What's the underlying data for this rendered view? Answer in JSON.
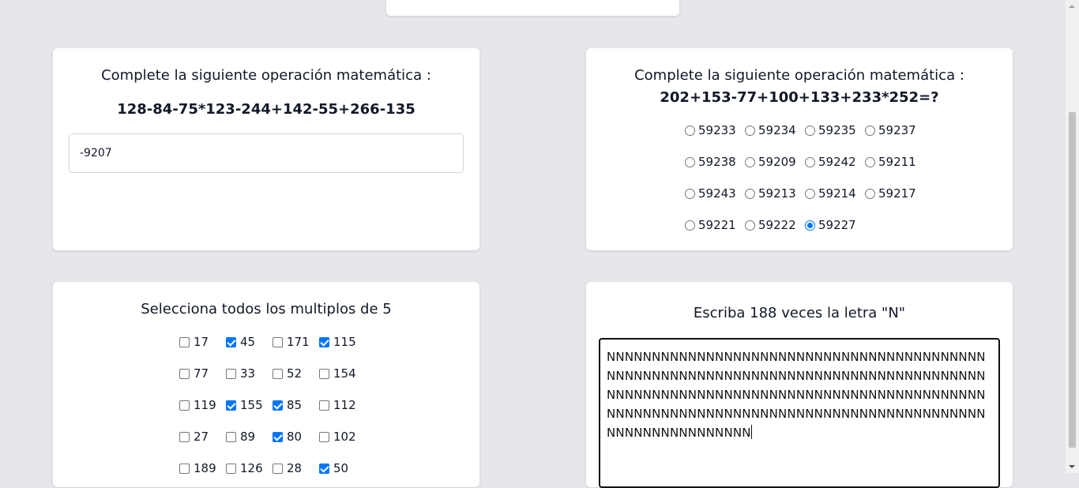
{
  "q1": {
    "title": "Complete la siguiente operación matemática :",
    "expression": "128-84-75*123-244+142-55+266-135",
    "input_value": "-9207"
  },
  "q2": {
    "title": "Complete la siguiente operación matemática :",
    "expression": "202+153-77+100+133+233*252=?",
    "options": [
      {
        "label": "59233",
        "checked": false
      },
      {
        "label": "59234",
        "checked": false
      },
      {
        "label": "59235",
        "checked": false
      },
      {
        "label": "59237",
        "checked": false
      },
      {
        "label": "59238",
        "checked": false
      },
      {
        "label": "59209",
        "checked": false
      },
      {
        "label": "59242",
        "checked": false
      },
      {
        "label": "59211",
        "checked": false
      },
      {
        "label": "59243",
        "checked": false
      },
      {
        "label": "59213",
        "checked": false
      },
      {
        "label": "59214",
        "checked": false
      },
      {
        "label": "59217",
        "checked": false
      },
      {
        "label": "59221",
        "checked": false
      },
      {
        "label": "59222",
        "checked": false
      },
      {
        "label": "59227",
        "checked": true
      }
    ]
  },
  "q3": {
    "title": "Selecciona todos los multiplos de 5",
    "options": [
      {
        "label": "17",
        "checked": false
      },
      {
        "label": "45",
        "checked": true
      },
      {
        "label": "171",
        "checked": false
      },
      {
        "label": "115",
        "checked": true
      },
      {
        "label": "77",
        "checked": false
      },
      {
        "label": "33",
        "checked": false
      },
      {
        "label": "52",
        "checked": false
      },
      {
        "label": "154",
        "checked": false
      },
      {
        "label": "119",
        "checked": false
      },
      {
        "label": "155",
        "checked": true
      },
      {
        "label": "85",
        "checked": true
      },
      {
        "label": "112",
        "checked": false
      },
      {
        "label": "27",
        "checked": false
      },
      {
        "label": "89",
        "checked": false
      },
      {
        "label": "80",
        "checked": true
      },
      {
        "label": "102",
        "checked": false
      },
      {
        "label": "189",
        "checked": false
      },
      {
        "label": "126",
        "checked": false
      },
      {
        "label": "28",
        "checked": false
      },
      {
        "label": "50",
        "checked": true
      }
    ]
  },
  "q4": {
    "title": "Escriba 188 veces la letra \"N\"",
    "textarea_value": "NNNNNNNNNNNNNNNNNNNNNNNNNNNNNNNNNNNNNNNNNNNNNNNNNNNNNNNNNNNNNNNNNNNNNNNNNNNNNNNNNNNNNNNNNNNNNNNNNNNNNNNNNNNNNNNNNNNNNNNNNNNNNNNNNNNNNNNNNNNNNNNNNNNNNNNNNNNNNNNNNNNNNNNNNNNNNNNNNNNNNNNN"
  },
  "colors": {
    "background": "#e5e7eb",
    "card": "#ffffff",
    "accent": "#0075ff"
  }
}
